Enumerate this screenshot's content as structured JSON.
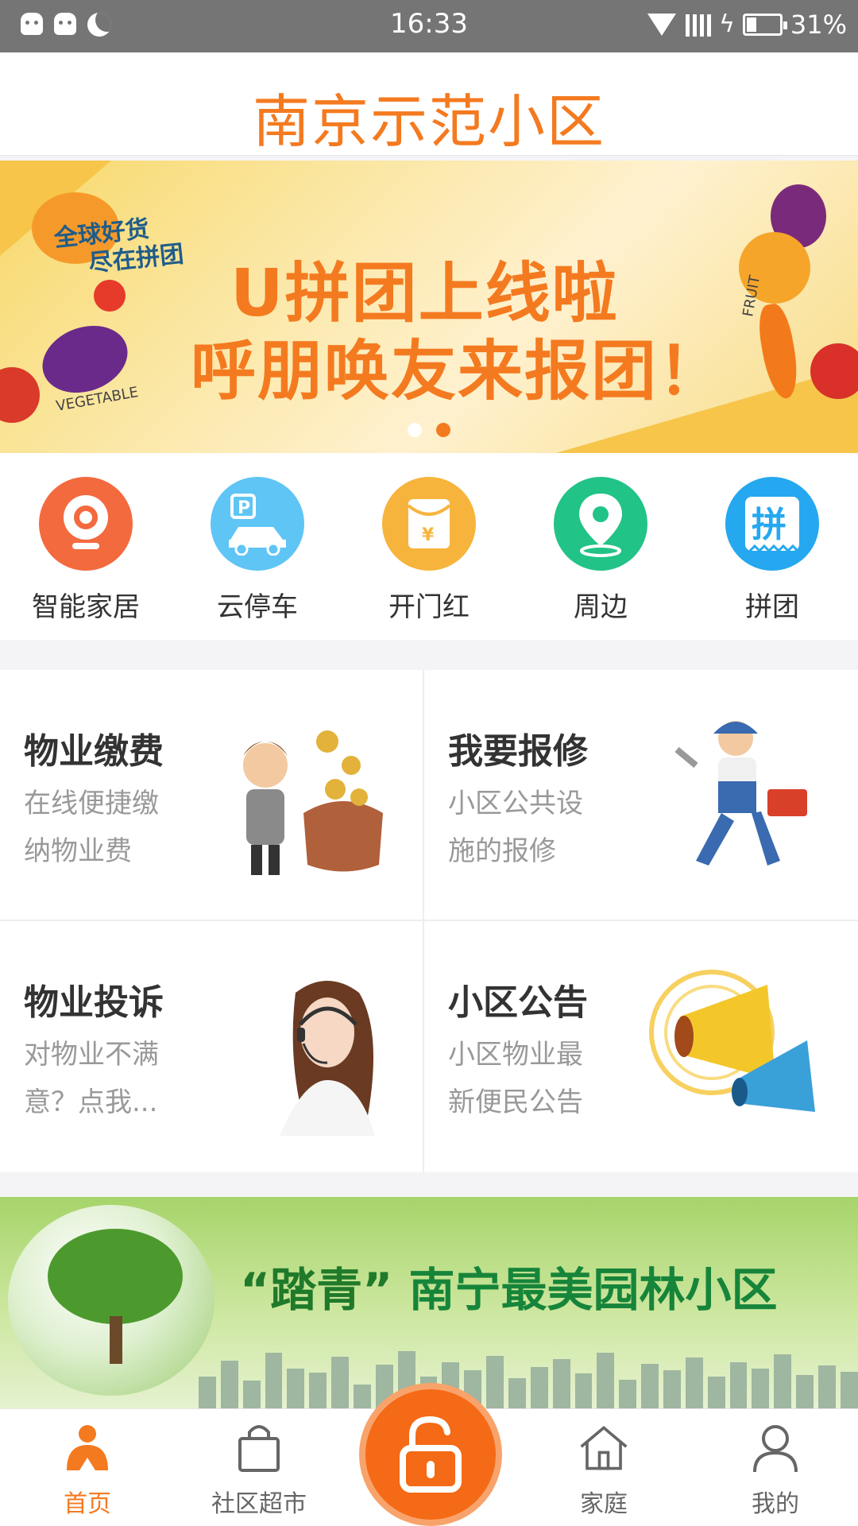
{
  "status_bar": {
    "time": "16:33",
    "battery": "31%",
    "battery_level": 0.31
  },
  "header": {
    "title": "南京示范小区"
  },
  "banner": {
    "tag_line1": "全球好货",
    "tag_line2": "尽在拼团",
    "line1": "U拼团上线啦",
    "line2": "呼朋唤友来报团！",
    "label_vegetable": "VEGETABLE",
    "label_fruit": "FRUIT",
    "page_count": 2,
    "active_index": 1
  },
  "quick_icons": [
    {
      "label": "智能家居",
      "icon": "camera-icon",
      "color": "#f36a3e"
    },
    {
      "label": "云停车",
      "icon": "parking-car-icon",
      "color": "#5fc5f5"
    },
    {
      "label": "开门红",
      "icon": "red-envelope-icon",
      "color": "#f7b43c"
    },
    {
      "label": "周边",
      "icon": "location-pin-icon",
      "color": "#22c387"
    },
    {
      "label": "拼团",
      "icon": "group-buy-icon",
      "color": "#25a8ef"
    }
  ],
  "services": [
    {
      "title": "物业缴费",
      "desc": "在线便捷缴纳物业费",
      "icon": "money-bag-icon"
    },
    {
      "title": "我要报修",
      "desc": "小区公共设施的报修",
      "icon": "repairman-icon"
    },
    {
      "title": "物业投诉",
      "desc": "对物业不满意？点我...",
      "icon": "customer-service-icon"
    },
    {
      "title": "小区公告",
      "desc": "小区物业最新便民公告",
      "icon": "megaphone-icon"
    }
  ],
  "promo": {
    "quote_word": "“踏青”",
    "text": "南宁最美园林小区"
  },
  "bottom_nav": {
    "items": [
      {
        "label": "首页",
        "icon": "home-person-icon",
        "active": true
      },
      {
        "label": "社区超市",
        "icon": "shopping-bag-icon",
        "active": false
      },
      {
        "label": "家庭",
        "icon": "house-icon",
        "active": false
      },
      {
        "label": "我的",
        "icon": "user-icon",
        "active": false
      }
    ],
    "center_icon": "unlock-icon"
  },
  "colors": {
    "accent": "#f47a20",
    "status_bar": "#757575"
  }
}
